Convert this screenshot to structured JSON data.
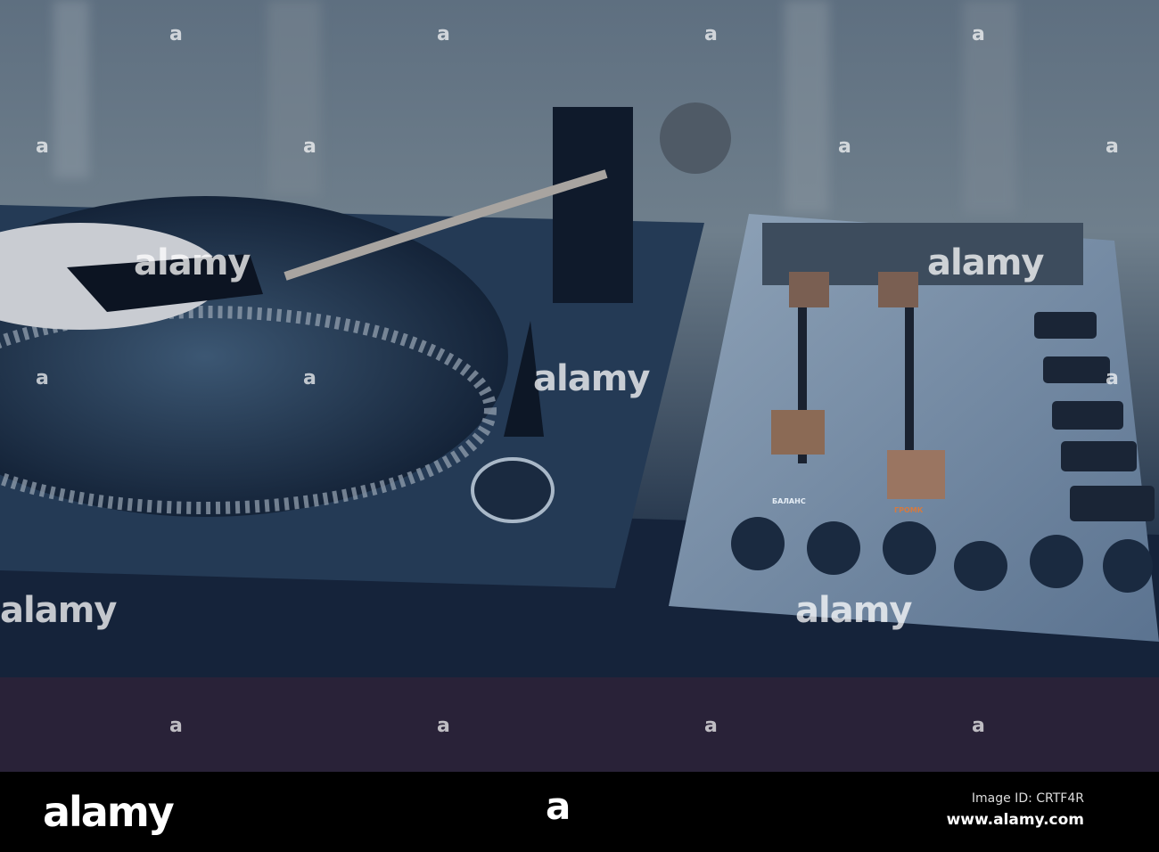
{
  "photo": {
    "subject": "turntable",
    "fader_labels": [
      "БАЛАНС",
      "ГРОМК"
    ]
  },
  "watermark": {
    "text": "alamy",
    "letter": "a"
  },
  "footer": {
    "logo": "alamy",
    "mark": "a",
    "image_id": "Image ID: CRTF4R",
    "url": "www.alamy.com"
  }
}
